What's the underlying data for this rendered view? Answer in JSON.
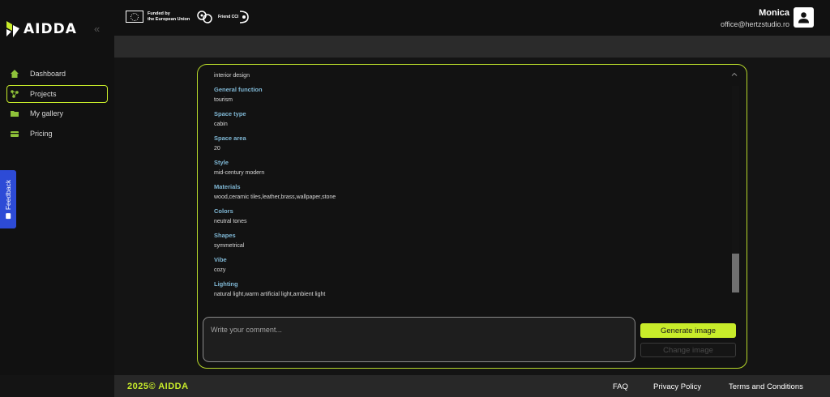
{
  "brand": {
    "name": "AIDDA",
    "accent": "#c8ec2a"
  },
  "sidebar": {
    "collapse_label": "«",
    "items": [
      {
        "label": "Dashboard",
        "icon": "home-icon",
        "active": false
      },
      {
        "label": "Projects",
        "icon": "projects-icon",
        "active": true
      },
      {
        "label": "My gallery",
        "icon": "folder-icon",
        "active": false
      },
      {
        "label": "Pricing",
        "icon": "pricing-icon",
        "active": false
      }
    ],
    "feedback_label": "Feedback"
  },
  "header": {
    "eu_text_line1": "Funded by",
    "eu_text_line2": "the European Union",
    "friend_text": "Friend CCI",
    "user_name": "Monica",
    "user_email": "office@hertzstudio.ro"
  },
  "details": {
    "top_value": "interior design",
    "fields": [
      {
        "label": "General function",
        "value": "tourism"
      },
      {
        "label": "Space type",
        "value": "cabin"
      },
      {
        "label": "Space area",
        "value": "20"
      },
      {
        "label": "Style",
        "value": "mid-century modern"
      },
      {
        "label": "Materials",
        "value": "wood,ceramic tiles,leather,brass,wallpaper,stone"
      },
      {
        "label": "Colors",
        "value": "neutral tones"
      },
      {
        "label": "Shapes",
        "value": "symmetrical"
      },
      {
        "label": "Vibe",
        "value": "cozy"
      },
      {
        "label": "Lighting",
        "value": "natural light,warm artificial light,ambient light"
      }
    ]
  },
  "comment": {
    "placeholder": "Write your comment..."
  },
  "actions": {
    "generate_label": "Generate image",
    "change_label": "Change image"
  },
  "footer": {
    "copyright": "2025© AIDDA",
    "links": [
      "FAQ",
      "Privacy Policy",
      "Terms and Conditions"
    ]
  }
}
